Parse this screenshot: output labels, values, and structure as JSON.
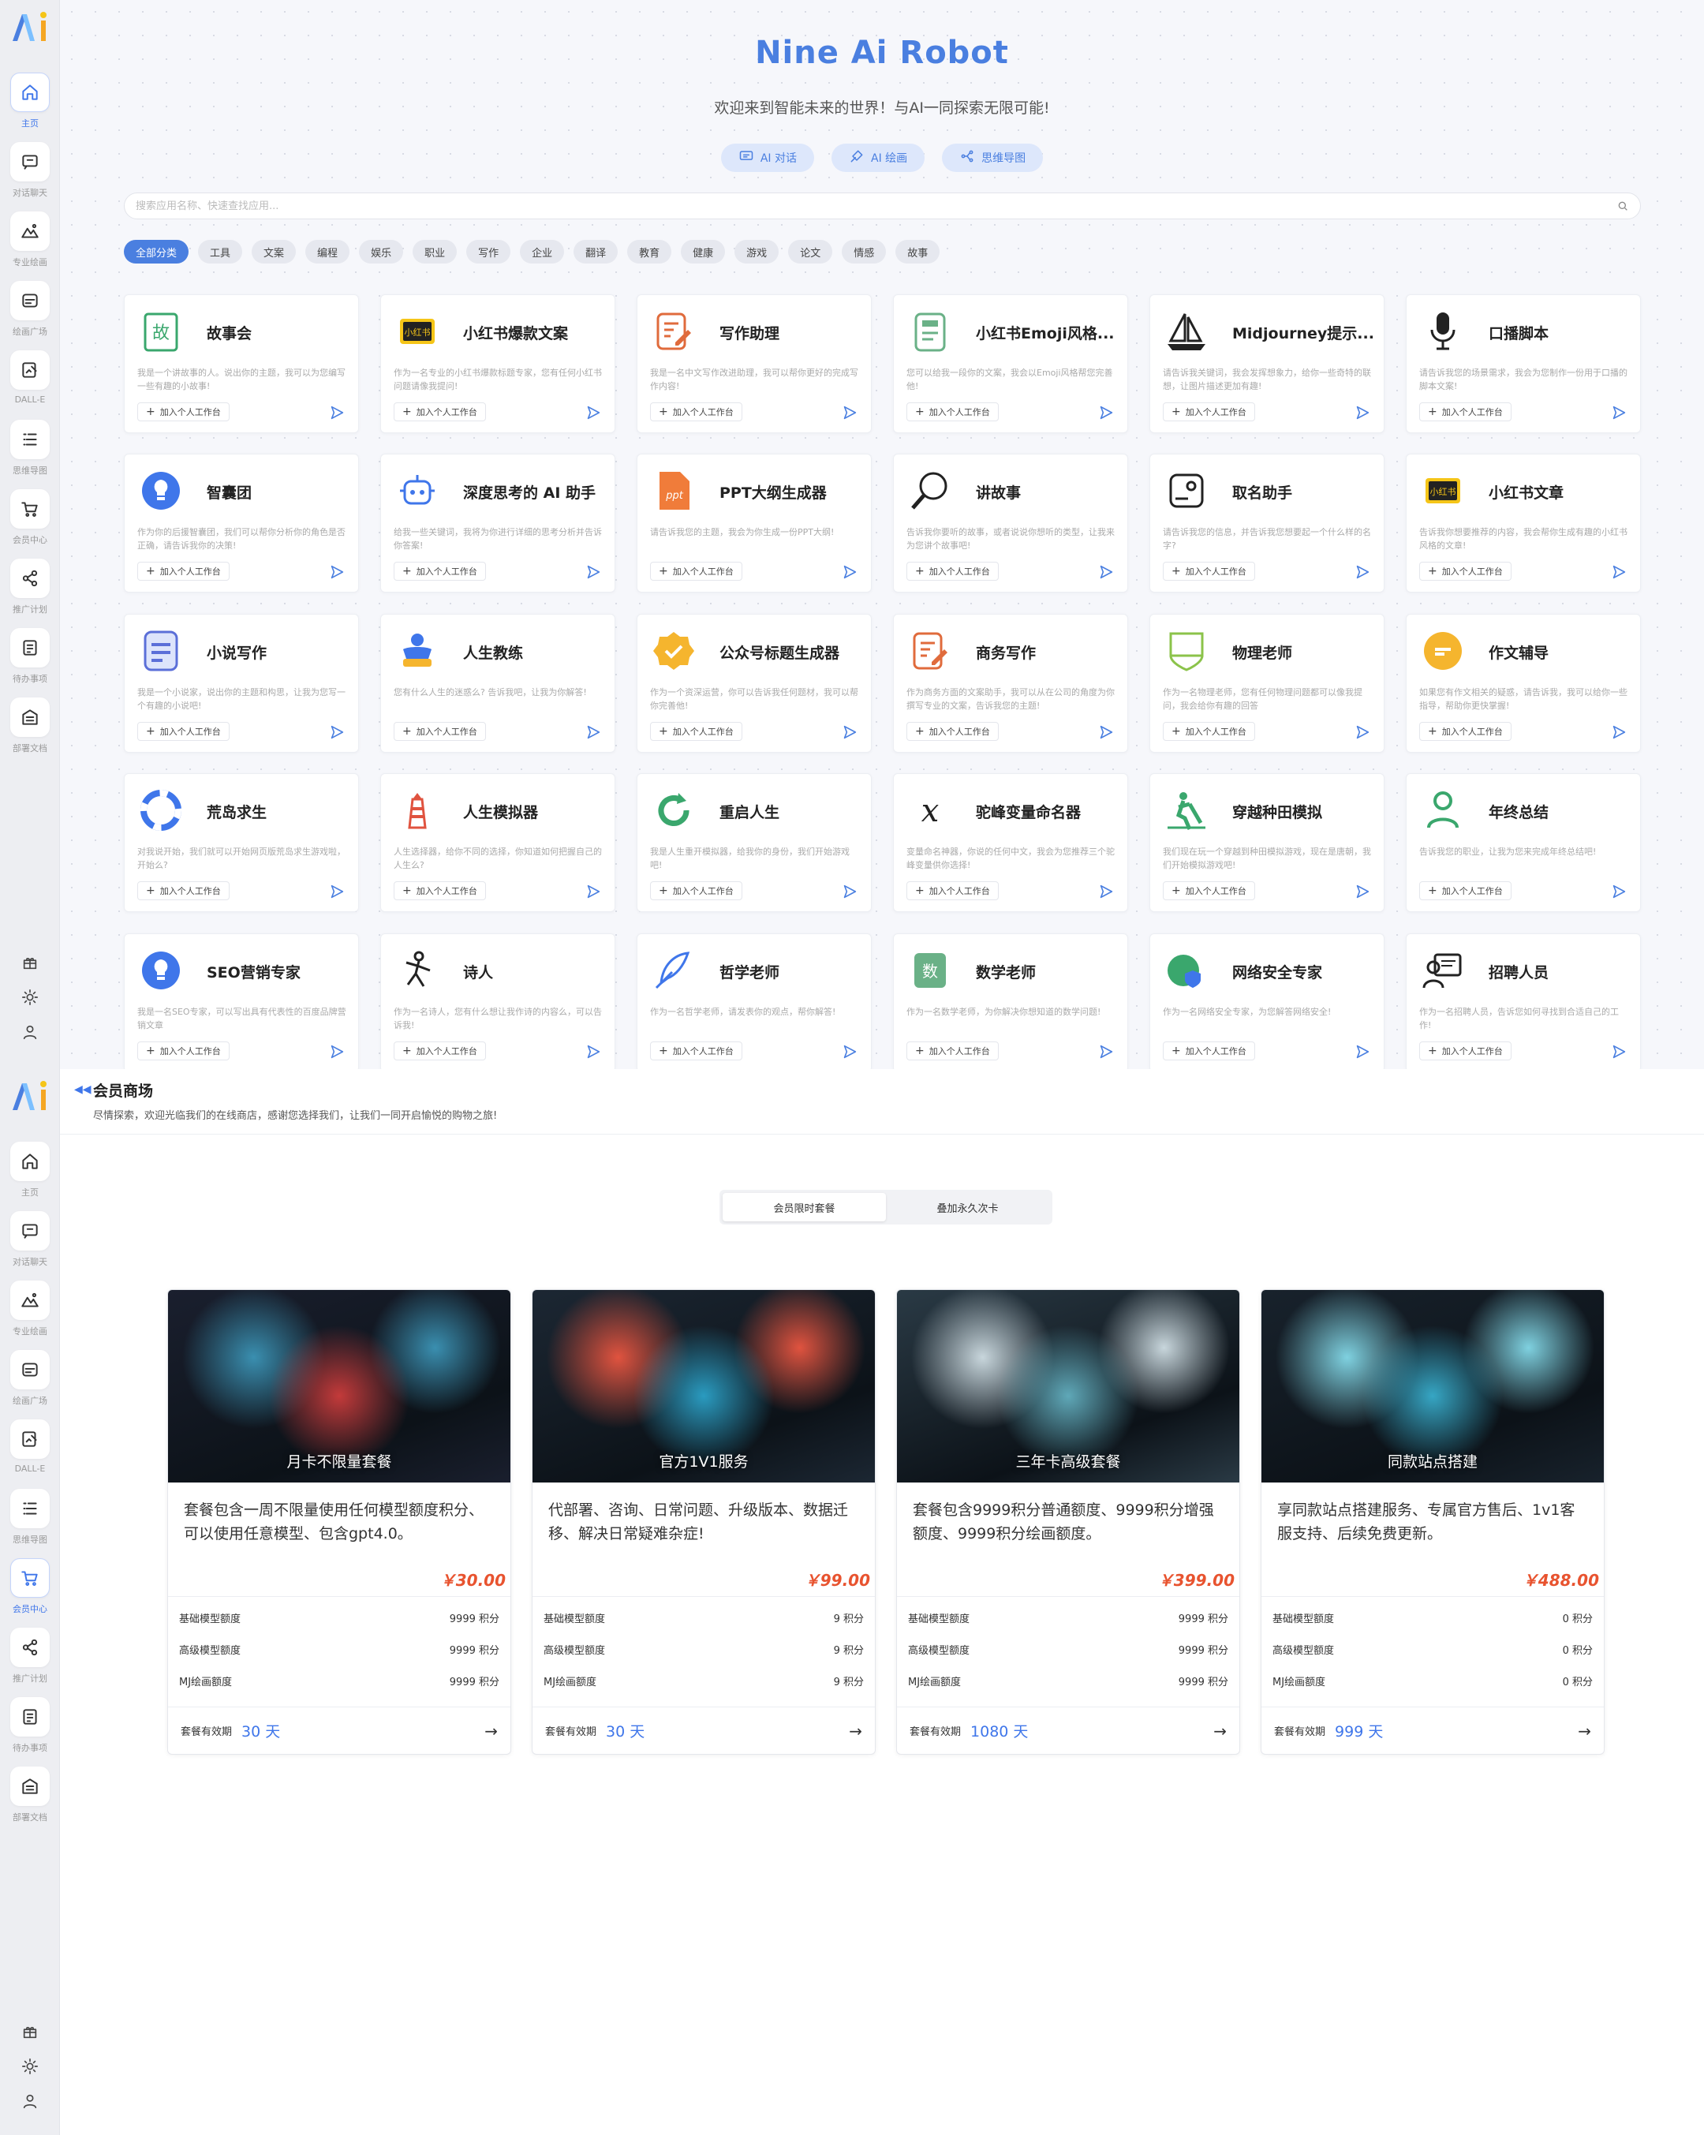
{
  "sidebar": {
    "nav": [
      {
        "label": "主页",
        "icon": "home-icon"
      },
      {
        "label": "对话聊天",
        "icon": "chat-icon"
      },
      {
        "label": "专业绘画",
        "icon": "mountain-icon"
      },
      {
        "label": "绘画广场",
        "icon": "gallery-icon"
      },
      {
        "label": "DALL-E",
        "icon": "image-edit-icon"
      },
      {
        "label": "思维导图",
        "icon": "list-icon"
      },
      {
        "label": "会员中心",
        "icon": "cart-icon"
      },
      {
        "label": "推广计划",
        "icon": "share-icon"
      },
      {
        "label": "待办事项",
        "icon": "todo-icon"
      },
      {
        "label": "部署文档",
        "icon": "doc-icon"
      }
    ],
    "bottom_icons": [
      "gift-icon",
      "sun-icon",
      "user-icon"
    ]
  },
  "apps_page": {
    "title": "Nine Ai Robot",
    "subtitle": "欢迎来到智能未来的世界！与AI一同探索无限可能!",
    "pills": [
      {
        "label": "AI 对话",
        "icon": "chat-icon"
      },
      {
        "label": "AI 绘画",
        "icon": "brush-icon"
      },
      {
        "label": "思维导图",
        "icon": "mindmap-icon"
      }
    ],
    "search_placeholder": "搜索应用名称、快速查找应用...",
    "categories": [
      "全部分类",
      "工具",
      "文案",
      "编程",
      "娱乐",
      "职业",
      "写作",
      "企业",
      "翻译",
      "教育",
      "健康",
      "游戏",
      "论文",
      "情感",
      "故事"
    ],
    "add_label": "加入个人工作台",
    "apps": [
      {
        "name": "故事会",
        "desc": "我是一个讲故事的人。说出你的主题，我可以为您编写一些有趣的小故事!",
        "icon": "story-icon",
        "color": "#3aa76d"
      },
      {
        "name": "小红书爆款文案",
        "desc": "作为一名专业的小红书爆款标题专家，您有任何小红书问题请像我提问!",
        "icon": "xiaohongshu-icon",
        "color": "#f5c518"
      },
      {
        "name": "写作助理",
        "desc": "我是一名中文写作改进助理，我可以帮你更好的完成写作内容!",
        "icon": "writing-icon",
        "color": "#e06b3c"
      },
      {
        "name": "小红书Emoji风格...",
        "desc": "您可以给我一段你的文案，我会以Emoji风格帮您完善他!",
        "icon": "notebook-icon",
        "color": "#6ab187"
      },
      {
        "name": "Midjourney提示...",
        "desc": "请告诉我关键词，我会发挥想象力，给你一些奇特的联想，让图片描述更加有趣!",
        "icon": "sailboat-icon",
        "color": "#222222"
      },
      {
        "name": "口播脚本",
        "desc": "请告诉我您的场景需求，我会为您制作一份用于口播的脚本文案!",
        "icon": "microphone-icon",
        "color": "#222222"
      },
      {
        "name": "智囊团",
        "desc": "作为你的后援智囊团，我们可以帮你分析你的角色是否正确，请告诉我你的决策!",
        "icon": "lightbulb-icon",
        "color": "#3f76ea"
      },
      {
        "name": "深度思考的 AI 助手",
        "desc": "给我一些关键词，我将为你进行详细的思考分析并告诉你答案!",
        "icon": "robot-icon",
        "color": "#3f76ea"
      },
      {
        "name": "PPT大纲生成器",
        "desc": "请告诉我您的主题，我会为你生成一份PPT大纲!",
        "icon": "ppt-icon",
        "color": "#f07c3a"
      },
      {
        "name": "讲故事",
        "desc": "告诉我你要听的故事，或者说说你想听的类型，让我来为您讲个故事吧!",
        "icon": "magnifier-icon",
        "color": "#222222"
      },
      {
        "name": "取名助手",
        "desc": "请告诉我您的信息，并告诉我您想要起一个什么样的名字?",
        "icon": "name-card-icon",
        "color": "#222222"
      },
      {
        "name": "小红书文章",
        "desc": "告诉我你想要推荐的内容，我会帮你生成有趣的小红书风格的文章!",
        "icon": "xiaohongshu-icon",
        "color": "#f5c518"
      },
      {
        "name": "小说写作",
        "desc": "我是一个小说家，说出你的主题和构思，让我为您写一个有趣的小说吧!",
        "icon": "novel-icon",
        "color": "#5b6fd8"
      },
      {
        "name": "人生教练",
        "desc": "您有什么人生的迷惑么? 告诉我吧，让我为你解答!",
        "icon": "coach-icon",
        "color": "#3f76ea"
      },
      {
        "name": "公众号标题生成器",
        "desc": "作为一个资深运营，你可以告诉我任何题材，我可以帮你完善他!",
        "icon": "badge-check-icon",
        "color": "#f5b52e"
      },
      {
        "name": "商务写作",
        "desc": "作为商务方面的文案助手，我可以从在公司的角度为你撰写专业的文案，告诉我您的主题!",
        "icon": "writing-icon",
        "color": "#e06b3c"
      },
      {
        "name": "物理老师",
        "desc": "作为一名物理老师，您有任何物理问题都可以像我提问，我会给你有趣的回答",
        "icon": "shield-icon",
        "color": "#8bc34a"
      },
      {
        "name": "作文辅导",
        "desc": "如果您有作文相关的疑惑，请告诉我，我可以给你一些指导，帮助你更快掌握!",
        "icon": "message-circle-icon",
        "color": "#f5b52e"
      },
      {
        "name": "荒岛求生",
        "desc": "对我说开始，我们就可以开始网页版荒岛求生游戏啦，开始么?",
        "icon": "lifebuoy-icon",
        "color": "#3f76ea"
      },
      {
        "name": "人生模拟器",
        "desc": "人生选择器，给你不同的选择，你知道如何把握自己的人生么?",
        "icon": "lighthouse-icon",
        "color": "#e0533f"
      },
      {
        "name": "重启人生",
        "desc": "我是人生重开模拟器，给我你的身份，我们开始游戏吧!",
        "icon": "restart-icon",
        "color": "#3aa76d"
      },
      {
        "name": "驼峰变量命名器",
        "desc": "变量命名神器，你说的任何中文，我会为您推荐三个驼峰变量供你选择!",
        "icon": "variable-icon",
        "color": "#222222"
      },
      {
        "name": "穿越种田模拟",
        "desc": "我们现在玩一个穿越到种田模拟游戏，现在是唐朝，我们开始模拟游戏吧!",
        "icon": "farmer-icon",
        "color": "#3aa76d"
      },
      {
        "name": "年终总结",
        "desc": "告诉我您的职业，让我为您来完成年终总结吧!",
        "icon": "person-icon",
        "color": "#3aa76d"
      },
      {
        "name": "SEO营销专家",
        "desc": "我是一名SEO专家，可以写出具有代表性的百度品牌营销文章",
        "icon": "lightbulb-icon",
        "color": "#3f76ea"
      },
      {
        "name": "诗人",
        "desc": "作为一名诗人，您有什么想让我作诗的内容么，可以告诉我!",
        "icon": "poet-icon",
        "color": "#222222"
      },
      {
        "name": "哲学老师",
        "desc": "作为一名哲学老师，请发表你的观点，帮你解答!",
        "icon": "feather-icon",
        "color": "#3f76ea"
      },
      {
        "name": "数学老师",
        "desc": "作为一名数学老师，为你解决你想知道的数学问题!",
        "icon": "math-book-icon",
        "color": "#6ab187"
      },
      {
        "name": "网络安全专家",
        "desc": "作为一名网络安全专家，为您解答网络安全!",
        "icon": "globe-shield-icon",
        "color": "#3aa76d"
      },
      {
        "name": "招聘人员",
        "desc": "作为一名招聘人员，告诉您如何寻找到合适自己的工作!",
        "icon": "recruiter-icon",
        "color": "#222222"
      }
    ]
  },
  "shop_page": {
    "back_icon": "back-icon",
    "title": "会员商场",
    "subtitle": "尽情探索，欢迎光临我们的在线商店，感谢您选择我们，让我们一同开启愉悦的购物之旅!",
    "tabs": [
      {
        "label": "会员限时套餐",
        "active": true
      },
      {
        "label": "叠加永久次卡",
        "active": false
      }
    ],
    "validity_label": "套餐有效期",
    "packages": [
      {
        "image_caption": "月卡不限量套餐",
        "desc": "套餐包含一周不限量使用任何模型额度积分、可以使用任意模型、包含gpt4.0。",
        "price": "￥30.00",
        "rows": [
          {
            "label": "基础模型额度",
            "value": "9999 积分"
          },
          {
            "label": "高级模型额度",
            "value": "9999 积分"
          },
          {
            "label": "MJ绘画额度",
            "value": "9999 积分"
          }
        ],
        "validity": "30 天",
        "art": [
          "#1a1f2e",
          "#c33a3a",
          "#3a8fb0"
        ]
      },
      {
        "image_caption": "官方1V1服务",
        "desc": "代部署、咨询、日常问题、升级版本、数据迁移、解决日常疑难杂症!",
        "price": "￥99.00",
        "rows": [
          {
            "label": "基础模型额度",
            "value": "9 积分"
          },
          {
            "label": "高级模型额度",
            "value": "9 积分"
          },
          {
            "label": "MJ绘画额度",
            "value": "9 积分"
          }
        ],
        "validity": "30 天",
        "art": [
          "#1c2733",
          "#2a9bc0",
          "#e0533f"
        ]
      },
      {
        "image_caption": "三年卡高级套餐",
        "desc": "套餐包含9999积分普通额度、9999积分增强额度、9999积分绘画额度。",
        "price": "￥399.00",
        "rows": [
          {
            "label": "基础模型额度",
            "value": "9999 积分"
          },
          {
            "label": "高级模型额度",
            "value": "9999 积分"
          },
          {
            "label": "MJ绘画额度",
            "value": "9999 积分"
          }
        ],
        "validity": "1080 天",
        "art": [
          "#2a3a45",
          "#5fa8b8",
          "#c8d6dc"
        ]
      },
      {
        "image_caption": "同款站点搭建",
        "desc": "享同款站点搭建服务、专属官方售后、1v1客服支持、后续免费更新。",
        "price": "￥488.00",
        "rows": [
          {
            "label": "基础模型额度",
            "value": "0 积分"
          },
          {
            "label": "高级模型额度",
            "value": "0 积分"
          },
          {
            "label": "MJ绘画额度",
            "value": "0 积分"
          }
        ],
        "validity": "999 天",
        "art": [
          "#18222c",
          "#36a6c4",
          "#7fd1e0"
        ]
      }
    ]
  }
}
